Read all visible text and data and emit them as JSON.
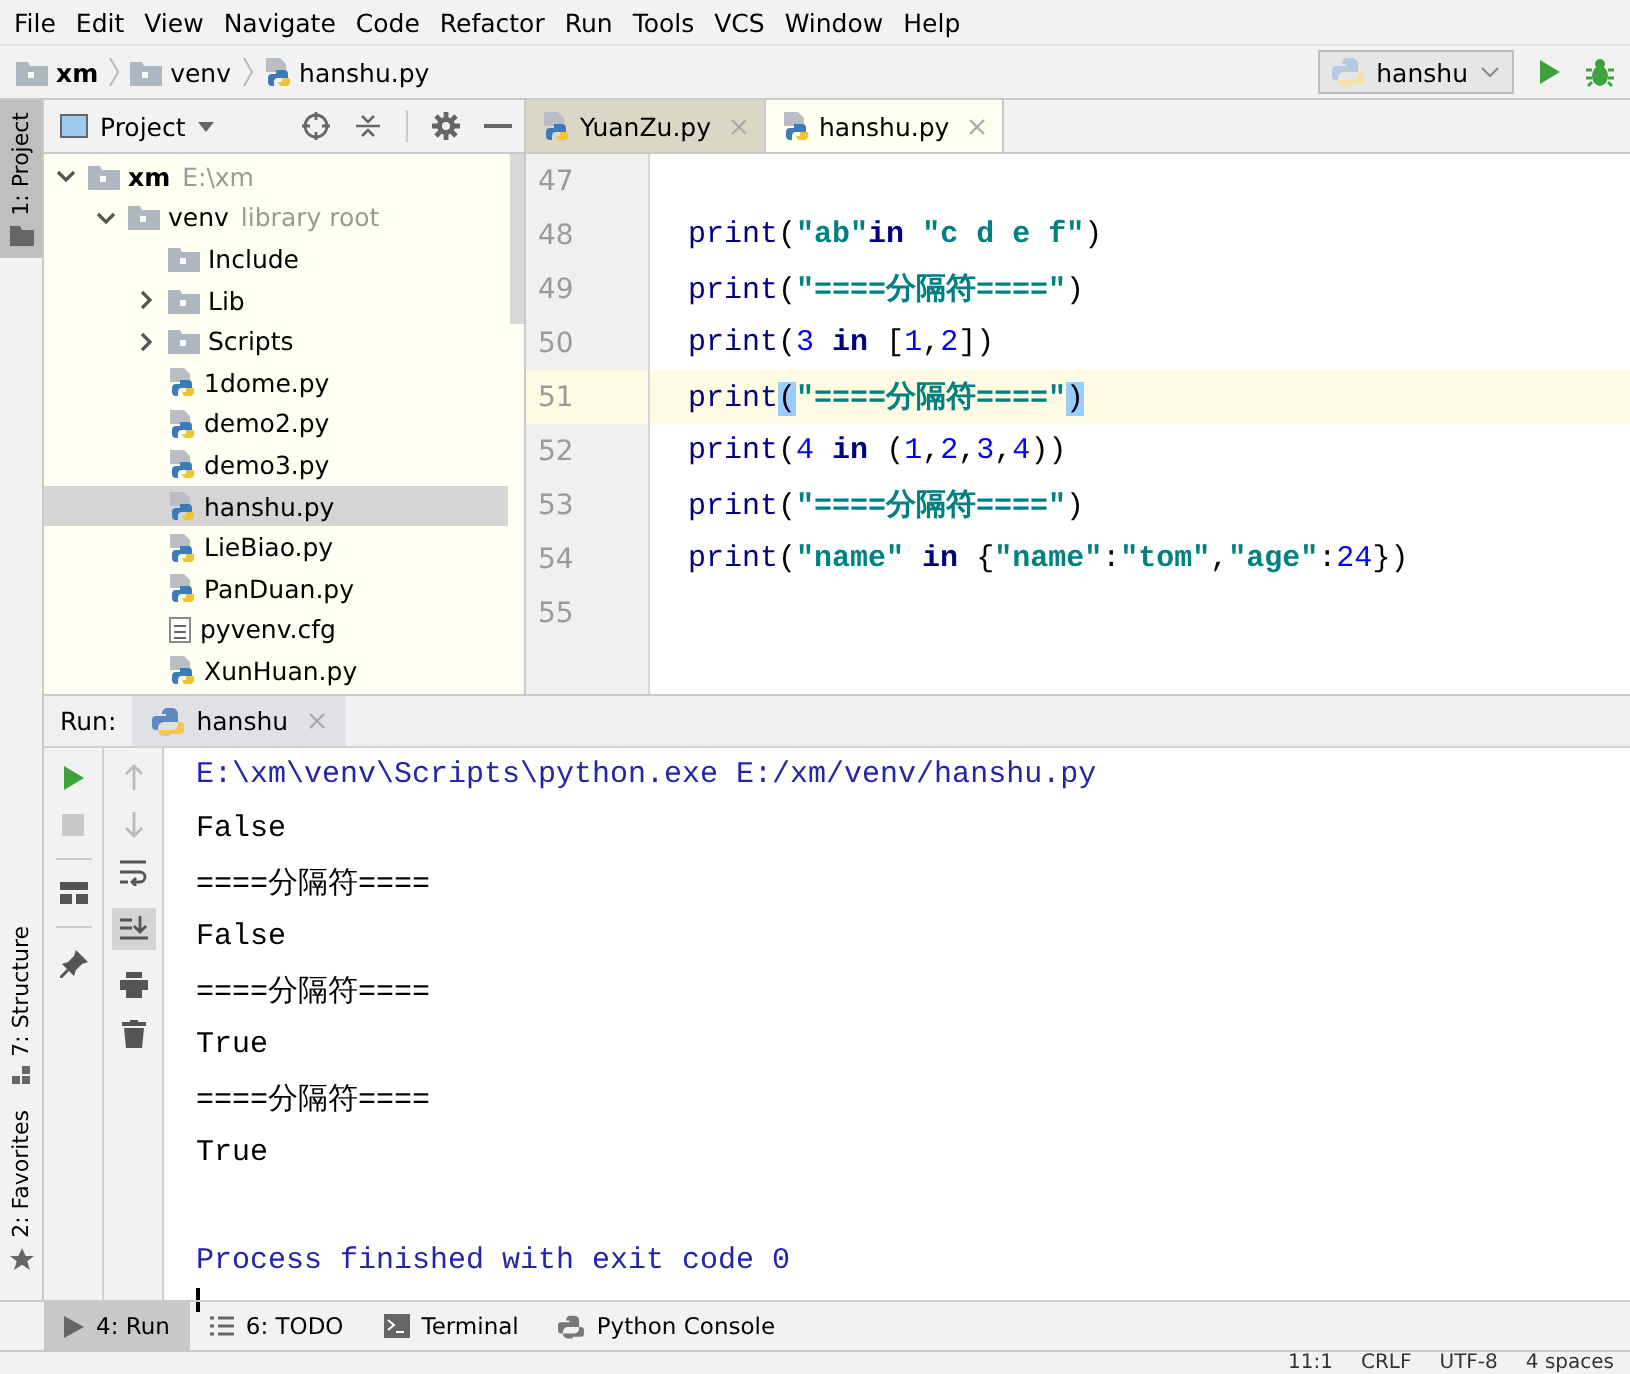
{
  "menu": [
    "File",
    "Edit",
    "View",
    "Navigate",
    "Code",
    "Refactor",
    "Run",
    "Tools",
    "VCS",
    "Window",
    "Help"
  ],
  "breadcrumbs": [
    {
      "label": "xm",
      "kind": "folder",
      "bold": true
    },
    {
      "label": "venv",
      "kind": "folder",
      "bold": false
    },
    {
      "label": "hanshu.py",
      "kind": "py",
      "bold": false
    }
  ],
  "run_config": {
    "label": "hanshu"
  },
  "side_tabs_top": [
    {
      "label": "1: Project",
      "selected": true
    }
  ],
  "side_tabs_bottom": [
    {
      "label": "7: Structure",
      "selected": false
    },
    {
      "label": "2: Favorites",
      "selected": false
    }
  ],
  "project_panel": {
    "title": "Project",
    "tree": [
      {
        "label": "xm",
        "hint": "E:\\xm",
        "kind": "root",
        "selected": false,
        "expanded": true,
        "children": [
          {
            "label": "venv",
            "hint": "library root",
            "kind": "folder",
            "selected": false,
            "expanded": true,
            "children": [
              {
                "label": "Include",
                "kind": "folder",
                "selected": false
              },
              {
                "label": "Lib",
                "kind": "folder",
                "selected": false,
                "expanded": false
              },
              {
                "label": "Scripts",
                "kind": "folder",
                "selected": false,
                "expanded": false
              },
              {
                "label": "1dome.py",
                "kind": "py",
                "selected": false
              },
              {
                "label": "demo2.py",
                "kind": "py",
                "selected": false
              },
              {
                "label": "demo3.py",
                "kind": "py",
                "selected": false
              },
              {
                "label": "hanshu.py",
                "kind": "py",
                "selected": true
              },
              {
                "label": "LieBiao.py",
                "kind": "py",
                "selected": false
              },
              {
                "label": "PanDuan.py",
                "kind": "py",
                "selected": false
              },
              {
                "label": "pyvenv.cfg",
                "kind": "cfg",
                "selected": false
              },
              {
                "label": "XunHuan.py",
                "kind": "py",
                "selected": false
              }
            ]
          }
        ]
      }
    ]
  },
  "editor": {
    "tabs": [
      {
        "label": "YuanZu.py",
        "selected": false
      },
      {
        "label": "hanshu.py",
        "selected": true
      }
    ],
    "lines": [
      {
        "number": "47",
        "current": false
      },
      {
        "number": "48",
        "current": false,
        "tokens": [
          {
            "t": "print",
            "kind": "name"
          },
          {
            "t": "(",
            "kind": "punct"
          },
          {
            "t": "\"ab\"",
            "kind": "string"
          },
          {
            "t": "in",
            "kind": "keyword"
          },
          {
            "t": " \"c d e f\"",
            "kind": "string"
          },
          {
            "t": ")",
            "kind": "punct"
          }
        ]
      },
      {
        "number": "49",
        "current": false,
        "tokens": [
          {
            "t": "print",
            "kind": "name"
          },
          {
            "t": "(",
            "kind": "punct"
          },
          {
            "t": "\"====分隔符====\"",
            "kind": "string"
          },
          {
            "t": ")",
            "kind": "punct"
          }
        ]
      },
      {
        "number": "50",
        "current": false,
        "tokens": [
          {
            "t": "print",
            "kind": "name"
          },
          {
            "t": "(",
            "kind": "punct"
          },
          {
            "t": "3 ",
            "kind": "number"
          },
          {
            "t": "in",
            "kind": "keyword"
          },
          {
            "t": " [",
            "kind": "punct"
          },
          {
            "t": "1",
            "kind": "number"
          },
          {
            "t": ",",
            "kind": "punct"
          },
          {
            "t": "2",
            "kind": "number"
          },
          {
            "t": "])",
            "kind": "punct"
          }
        ]
      },
      {
        "number": "51",
        "current": true,
        "tokens": [
          {
            "t": "print",
            "kind": "name"
          },
          {
            "t": "(",
            "kind": "brace"
          },
          {
            "t": "\"====分隔符====\"",
            "kind": "string"
          },
          {
            "t": ")",
            "kind": "brace"
          }
        ]
      },
      {
        "number": "52",
        "current": false,
        "tokens": [
          {
            "t": "print",
            "kind": "name"
          },
          {
            "t": "(",
            "kind": "punct"
          },
          {
            "t": "4 ",
            "kind": "number"
          },
          {
            "t": "in",
            "kind": "keyword"
          },
          {
            "t": " (",
            "kind": "punct"
          },
          {
            "t": "1",
            "kind": "number"
          },
          {
            "t": ",",
            "kind": "punct"
          },
          {
            "t": "2",
            "kind": "number"
          },
          {
            "t": ",",
            "kind": "punct"
          },
          {
            "t": "3",
            "kind": "number"
          },
          {
            "t": ",",
            "kind": "punct"
          },
          {
            "t": "4",
            "kind": "number"
          },
          {
            "t": "))",
            "kind": "punct"
          }
        ]
      },
      {
        "number": "53",
        "current": false,
        "tokens": [
          {
            "t": "print",
            "kind": "name"
          },
          {
            "t": "(",
            "kind": "punct"
          },
          {
            "t": "\"====分隔符====\"",
            "kind": "string"
          },
          {
            "t": ")",
            "kind": "punct"
          }
        ]
      },
      {
        "number": "54",
        "current": false,
        "tokens": [
          {
            "t": "print",
            "kind": "name"
          },
          {
            "t": "(",
            "kind": "punct"
          },
          {
            "t": "\"name\" ",
            "kind": "string"
          },
          {
            "t": "in",
            "kind": "keyword"
          },
          {
            "t": " {",
            "kind": "punct"
          },
          {
            "t": "\"name\"",
            "kind": "string"
          },
          {
            "t": ":",
            "kind": "punct"
          },
          {
            "t": "\"tom\"",
            "kind": "string"
          },
          {
            "t": ",",
            "kind": "punct"
          },
          {
            "t": "\"age\"",
            "kind": "string"
          },
          {
            "t": ":",
            "kind": "punct"
          },
          {
            "t": "24",
            "kind": "number"
          },
          {
            "t": "})",
            "kind": "punct"
          }
        ]
      },
      {
        "number": "55",
        "current": false
      }
    ]
  },
  "run_panel": {
    "label": "Run:",
    "tab": "hanshu",
    "console": [
      {
        "kind": "system",
        "text": "E:\\xm\\venv\\Scripts\\python.exe E:/xm/venv/hanshu.py"
      },
      {
        "kind": "output",
        "text": "False"
      },
      {
        "kind": "output",
        "text": "====分隔符===="
      },
      {
        "kind": "output",
        "text": "False"
      },
      {
        "kind": "output",
        "text": "====分隔符===="
      },
      {
        "kind": "output",
        "text": "True"
      },
      {
        "kind": "output",
        "text": "====分隔符===="
      },
      {
        "kind": "output",
        "text": "True"
      },
      {
        "kind": "blank"
      },
      {
        "kind": "system",
        "text": "Process finished with exit code 0"
      },
      {
        "kind": "cursor"
      }
    ]
  },
  "bottom_tabs": [
    {
      "label": "4: Run",
      "kind": "run",
      "selected": true
    },
    {
      "label": "6: TODO",
      "kind": "todo",
      "selected": false
    },
    {
      "label": "Terminal",
      "kind": "terminal",
      "selected": false
    },
    {
      "label": "Python Console",
      "kind": "console",
      "selected": false
    }
  ],
  "status_bar": [
    "11:1",
    "CRLF",
    "UTF-8",
    "4 spaces"
  ]
}
